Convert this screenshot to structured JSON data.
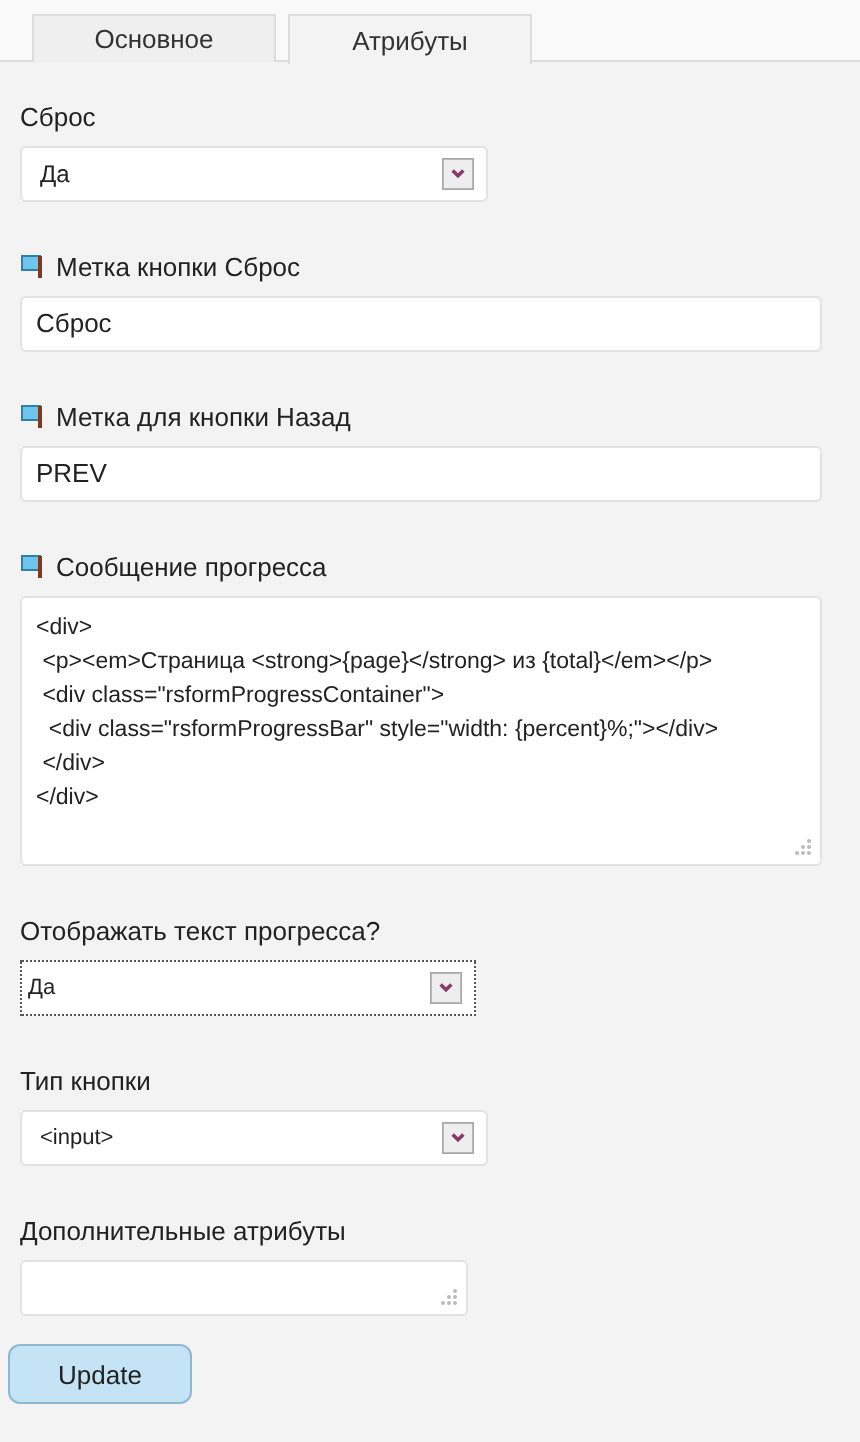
{
  "tabs": [
    {
      "label": "Основное",
      "selected": false
    },
    {
      "label": "Атрибуты",
      "selected": true
    }
  ],
  "fields": [
    {
      "kind": "select",
      "label": "Сброс",
      "translatable": false,
      "focused": false,
      "value": "Да"
    },
    {
      "kind": "text",
      "label": "Метка кнопки Сброс",
      "translatable": true,
      "focused": false,
      "value": "Сброс"
    },
    {
      "kind": "text",
      "label": "Метка для кнопки Назад",
      "translatable": true,
      "focused": false,
      "value": "PREV"
    },
    {
      "kind": "textarea",
      "label": "Сообщение прогресса",
      "translatable": true,
      "focused": false,
      "lines": [
        "<div>",
        " <p><em>Страница <strong>{page}</strong> из {total}</em></p>",
        " <div class=\"rsformProgressContainer\">",
        "  <div class=\"rsformProgressBar\" style=\"width: {percent}%;\"></div>",
        " </div>",
        "</div>"
      ]
    },
    {
      "kind": "select",
      "label": "Отображать текст прогресса?",
      "translatable": false,
      "focused": true,
      "value": "Да"
    },
    {
      "kind": "select",
      "label": "Тип кнопки",
      "translatable": false,
      "focused": false,
      "value": "<input>"
    },
    {
      "kind": "textarea-small",
      "label": "Дополнительные атрибуты",
      "translatable": false,
      "focused": false
    }
  ],
  "button": "Update"
}
